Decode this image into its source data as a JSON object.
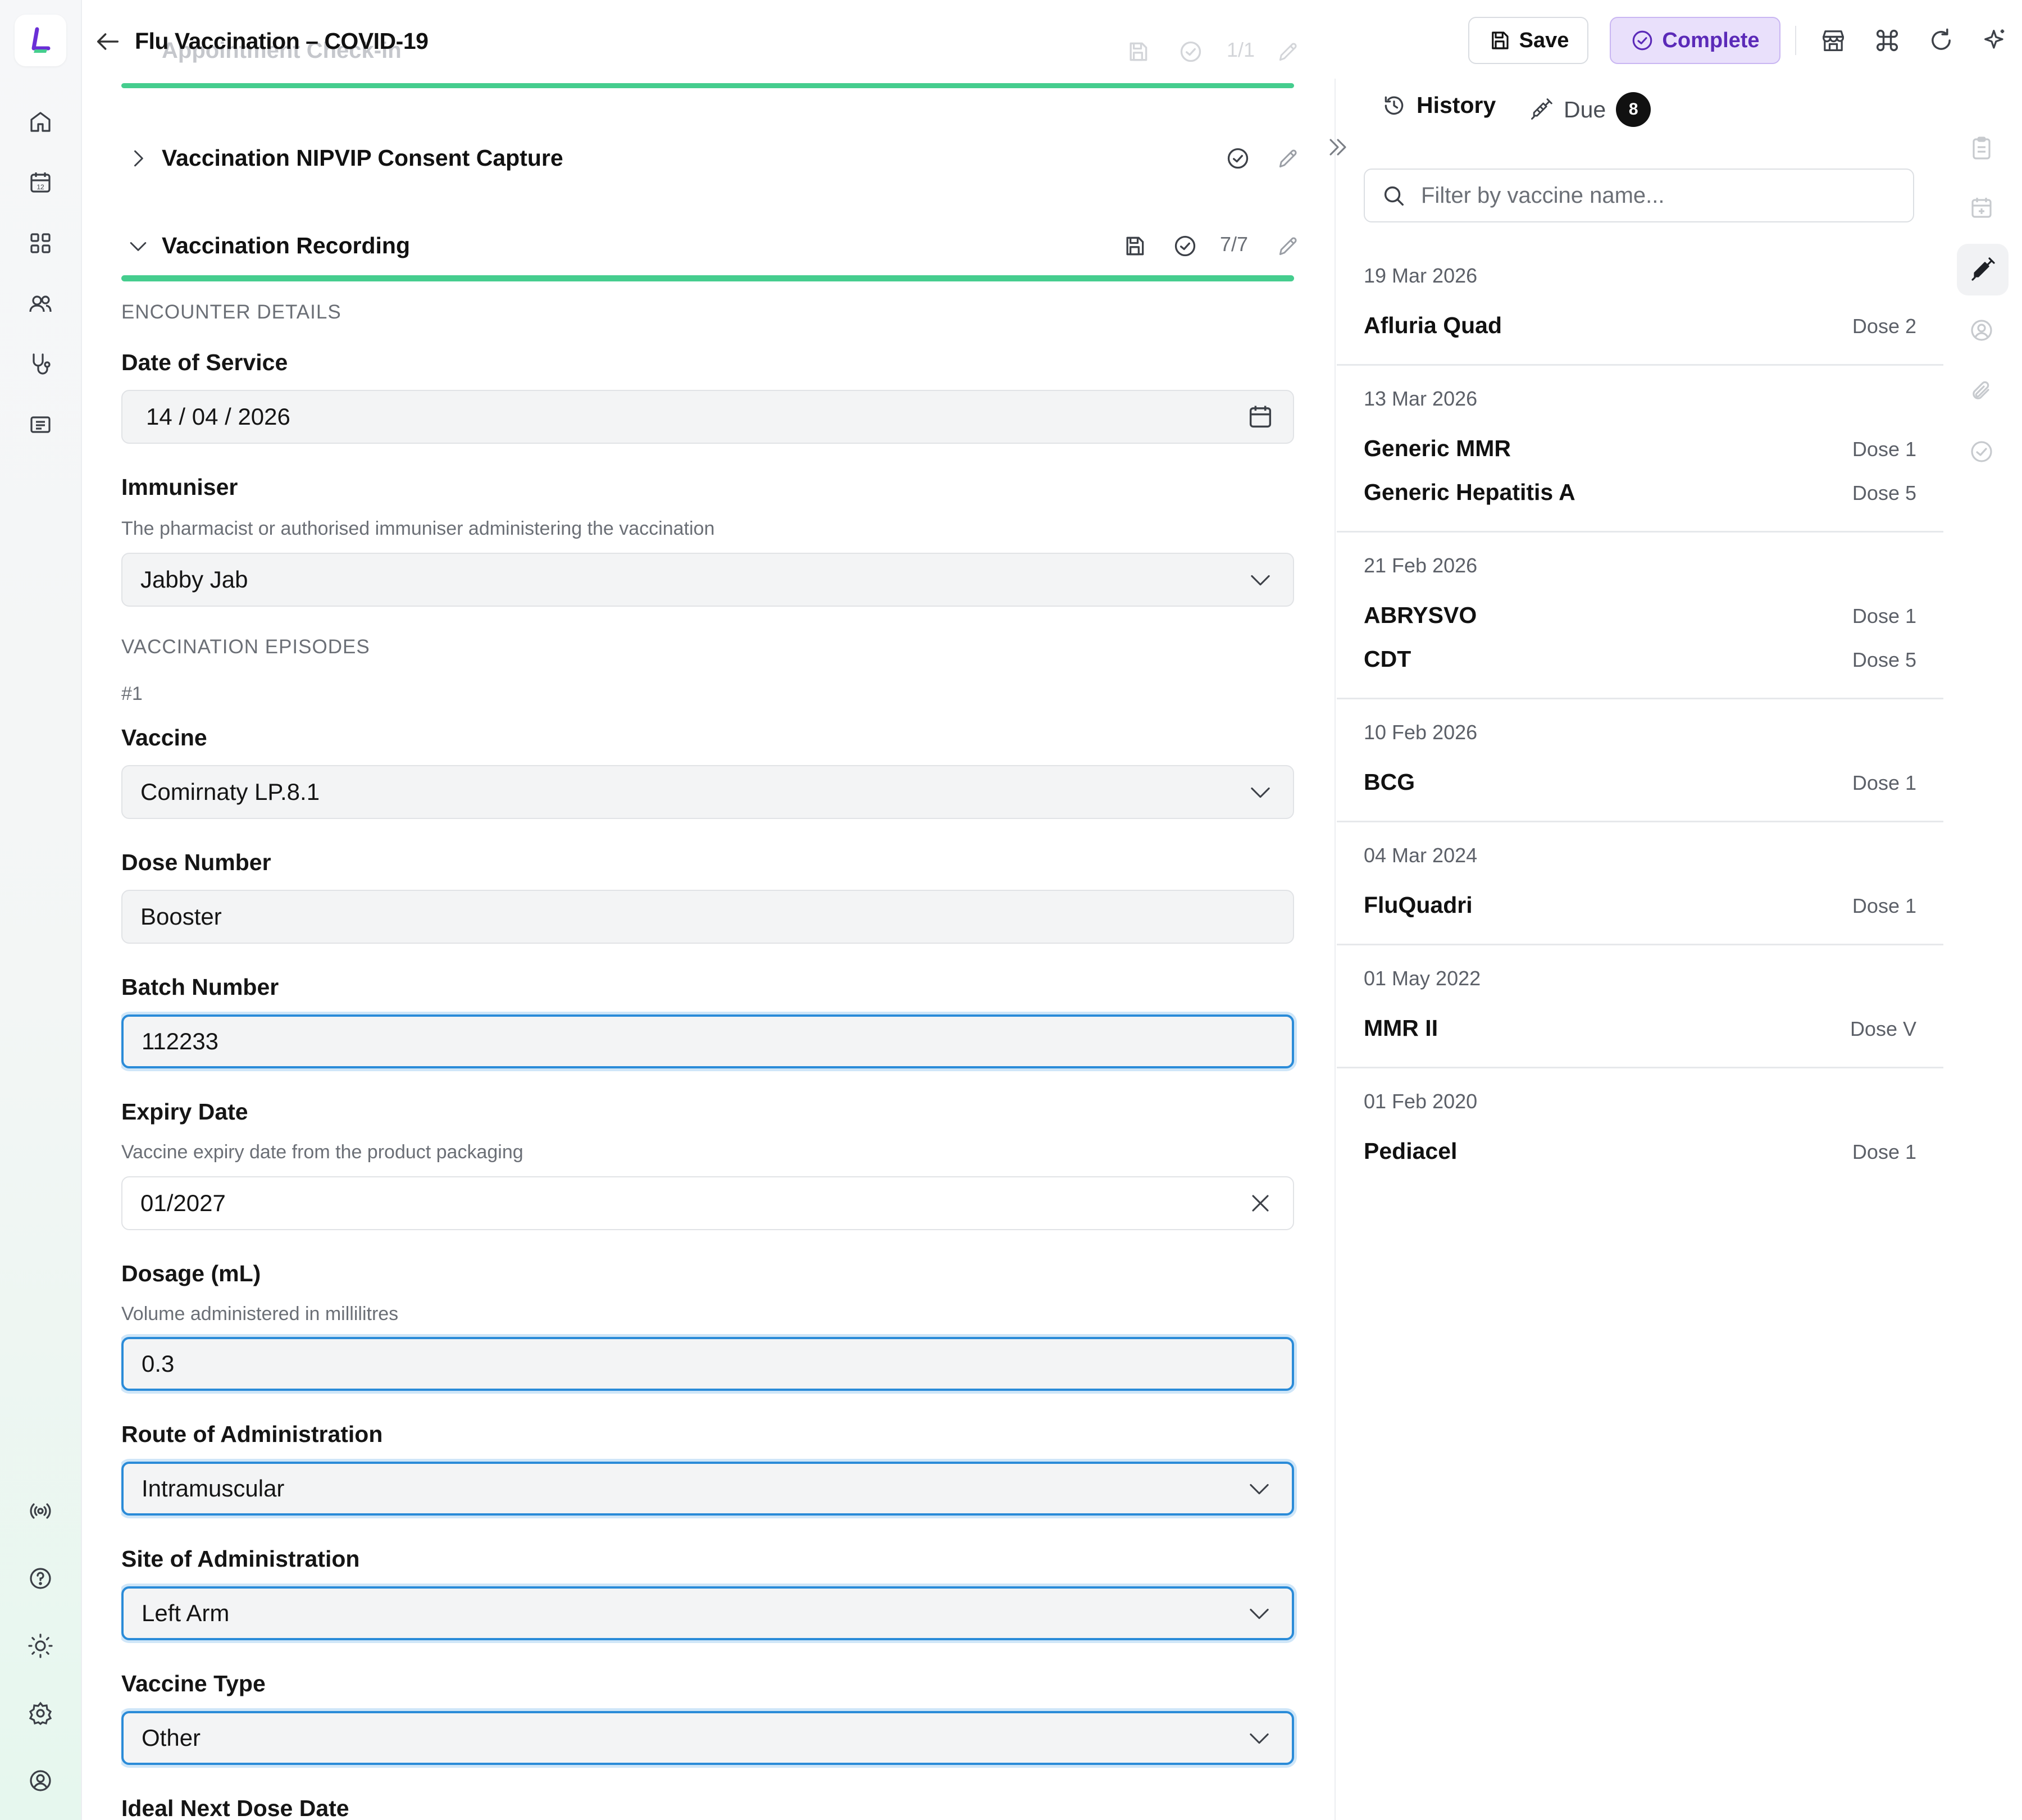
{
  "header": {
    "title": "Flu Vaccination – COVID-19",
    "save_label": "Save",
    "complete_label": "Complete"
  },
  "sections": {
    "checkin": {
      "title": "Appointment Check-in",
      "count": "1/1"
    },
    "consent": {
      "title": "Vaccination NIPVIP Consent Capture"
    },
    "recording": {
      "title": "Vaccination Recording",
      "count": "7/7"
    }
  },
  "form": {
    "encounter_group": "ENCOUNTER DETAILS",
    "date_of_service": {
      "label": "Date of Service",
      "value": "14 / 04 / 2026"
    },
    "immuniser": {
      "label": "Immuniser",
      "help": "The pharmacist or authorised immuniser administering the vaccination",
      "value": "Jabby Jab"
    },
    "episodes_group": "VACCINATION EPISODES",
    "episode_number": "#1",
    "vaccine": {
      "label": "Vaccine",
      "value": "Comirnaty LP.8.1"
    },
    "dose_number": {
      "label": "Dose Number",
      "value": "Booster"
    },
    "batch_number": {
      "label": "Batch Number",
      "value": "112233"
    },
    "expiry_date": {
      "label": "Expiry Date",
      "help": "Vaccine expiry date from the product packaging",
      "value": "01/2027"
    },
    "dosage": {
      "label": "Dosage (mL)",
      "help": "Volume administered in millilitres",
      "value": "0.3"
    },
    "route": {
      "label": "Route of Administration",
      "value": "Intramuscular"
    },
    "site": {
      "label": "Site of Administration",
      "value": "Left Arm"
    },
    "vaccine_type": {
      "label": "Vaccine Type",
      "value": "Other"
    },
    "ideal_next_dose": {
      "label": "Ideal Next Dose Date"
    }
  },
  "panel": {
    "history_tab": "History",
    "due_tab": "Due",
    "due_count": "8",
    "filter_placeholder": "Filter by vaccine name...",
    "history": [
      {
        "date": "19 Mar 2026",
        "items": [
          {
            "name": "Afluria Quad",
            "dose": "Dose 2"
          }
        ]
      },
      {
        "date": "13 Mar 2026",
        "items": [
          {
            "name": "Generic MMR",
            "dose": "Dose 1"
          },
          {
            "name": "Generic Hepatitis A",
            "dose": "Dose 5"
          }
        ]
      },
      {
        "date": "21 Feb 2026",
        "items": [
          {
            "name": "ABRYSVO",
            "dose": "Dose 1"
          },
          {
            "name": "CDT",
            "dose": "Dose 5"
          }
        ]
      },
      {
        "date": "10 Feb 2026",
        "items": [
          {
            "name": "BCG",
            "dose": "Dose 1"
          }
        ]
      },
      {
        "date": "04 Mar 2024",
        "items": [
          {
            "name": "FluQuadri",
            "dose": "Dose 1"
          }
        ]
      },
      {
        "date": "01 May 2022",
        "items": [
          {
            "name": "MMR II",
            "dose": "Dose V"
          }
        ]
      },
      {
        "date": "01 Feb 2020",
        "items": [
          {
            "name": "Pediacel",
            "dose": "Dose 1"
          }
        ]
      }
    ]
  },
  "colors": {
    "accent_green": "#45cd8e",
    "complete_purple": "#5b2ab8",
    "focus_blue": "#2a8bd8"
  },
  "icons": {
    "rail_top": [
      "home-icon",
      "calendar-icon",
      "grid-icon",
      "users-icon",
      "stethoscope-icon",
      "messages-icon"
    ],
    "rail_bottom": [
      "broadcast-icon",
      "help-icon",
      "sun-icon",
      "settings-icon",
      "account-icon"
    ],
    "toolbar": [
      "store-icon",
      "command-icon",
      "refresh-icon",
      "sparkle-icon"
    ],
    "side": [
      "clipboard-icon",
      "calendar-plus-icon",
      "syringe-icon",
      "user-circle-icon",
      "paperclip-icon",
      "check-circle-icon"
    ]
  }
}
